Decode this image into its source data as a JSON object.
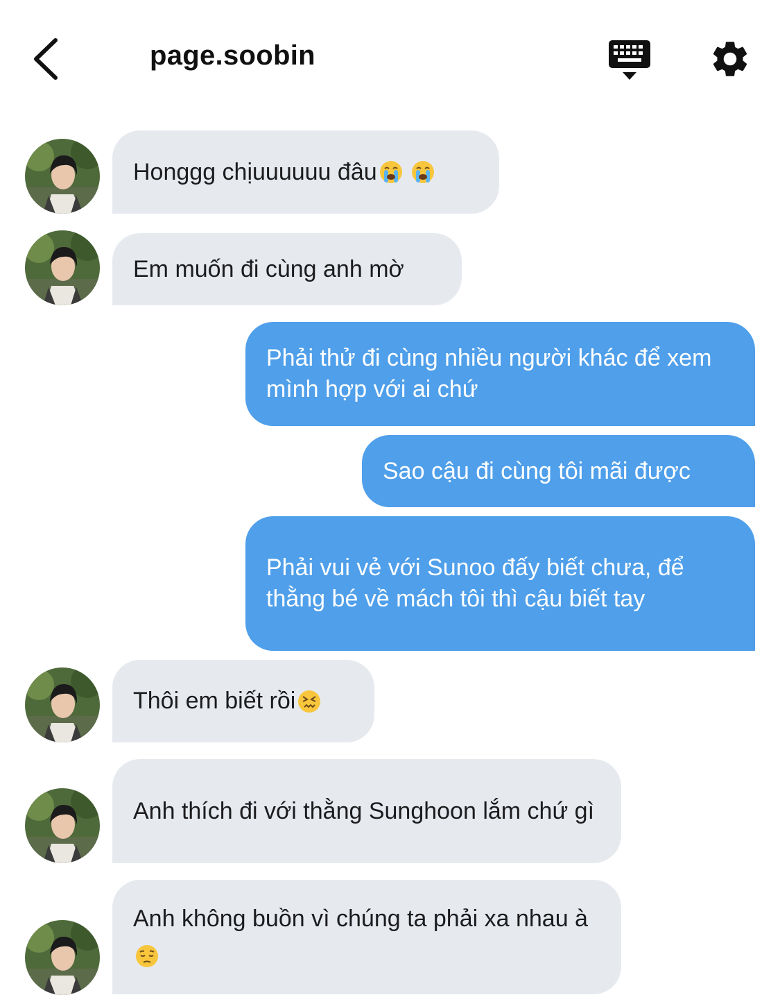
{
  "header": {
    "title": "page.soobin",
    "back_icon": "chevron-left-icon",
    "keyboard_icon": "keyboard-icon",
    "settings_icon": "gear-icon"
  },
  "colors": {
    "incoming_bubble": "#e6eaef",
    "outgoing_bubble": "#4f9fea",
    "outgoing_text": "#ffffff"
  },
  "messages": [
    {
      "sender": "them",
      "text": "Honggg chịuuuuuu đâu",
      "emoji": [
        "loudly-crying-face",
        "loudly-crying-face"
      ]
    },
    {
      "sender": "them",
      "text": "Em muốn đi cùng anh mờ",
      "emoji": []
    },
    {
      "sender": "me",
      "text": "Phải thử đi cùng nhiều người khác để xem mình hợp với ai chứ",
      "emoji": []
    },
    {
      "sender": "me",
      "text": "Sao cậu đi cùng tôi mãi được",
      "emoji": []
    },
    {
      "sender": "me",
      "text": "Phải vui vẻ với Sunoo đấy biết chưa, để thằng bé về mách tôi thì cậu biết tay",
      "emoji": []
    },
    {
      "sender": "them",
      "text": "Thôi em biết rồi",
      "emoji": [
        "confounded-face"
      ]
    },
    {
      "sender": "them",
      "text": "Anh thích đi với thằng Sunghoon lắm chứ gì",
      "emoji": []
    },
    {
      "sender": "them",
      "text": "Anh không buồn vì chúng ta phải xa nhau à",
      "emoji": [
        "pensive-face"
      ]
    }
  ]
}
